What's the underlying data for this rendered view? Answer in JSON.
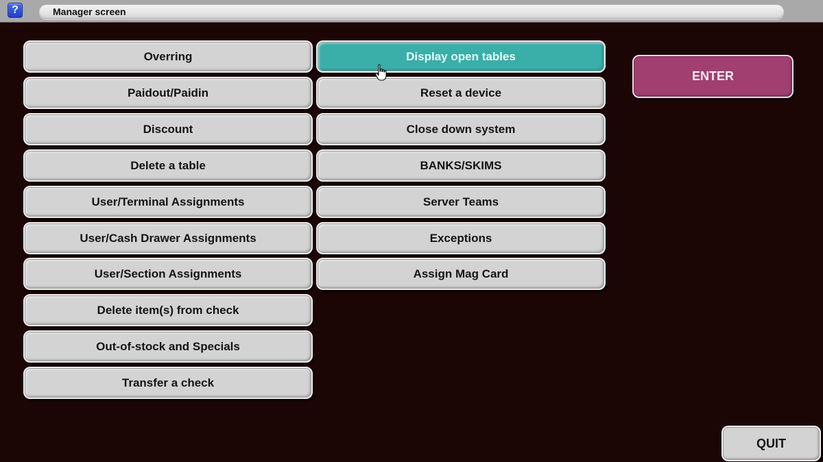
{
  "titlebar": {
    "help_icon": "question-mark-icon",
    "help_label": "?",
    "title": "Manager screen"
  },
  "left_column": [
    {
      "label": "Overring"
    },
    {
      "label": "Paidout/Paidin"
    },
    {
      "label": "Discount"
    },
    {
      "label": "Delete a table"
    },
    {
      "label": "User/Terminal Assignments"
    },
    {
      "label": "User/Cash Drawer Assignments"
    },
    {
      "label": "User/Section Assignments"
    },
    {
      "label": "Delete item(s) from check"
    },
    {
      "label": "Out-of-stock and Specials"
    },
    {
      "label": "Transfer a check"
    }
  ],
  "right_column": [
    {
      "label": "Display open tables",
      "state": "selected"
    },
    {
      "label": "Reset a device"
    },
    {
      "label": "Close down system"
    },
    {
      "label": "BANKS/SKIMS"
    },
    {
      "label": "Server Teams"
    },
    {
      "label": "Exceptions"
    },
    {
      "label": "Assign Mag Card"
    }
  ],
  "actions": {
    "enter_label": "ENTER",
    "quit_label": "QUIT"
  },
  "colors": {
    "background": "#1c0505",
    "button": "#d3d3d3",
    "selected_button": "#3aaea8",
    "enter_button": "#a03f70"
  },
  "pointer_icon": "hand-pointer-icon"
}
